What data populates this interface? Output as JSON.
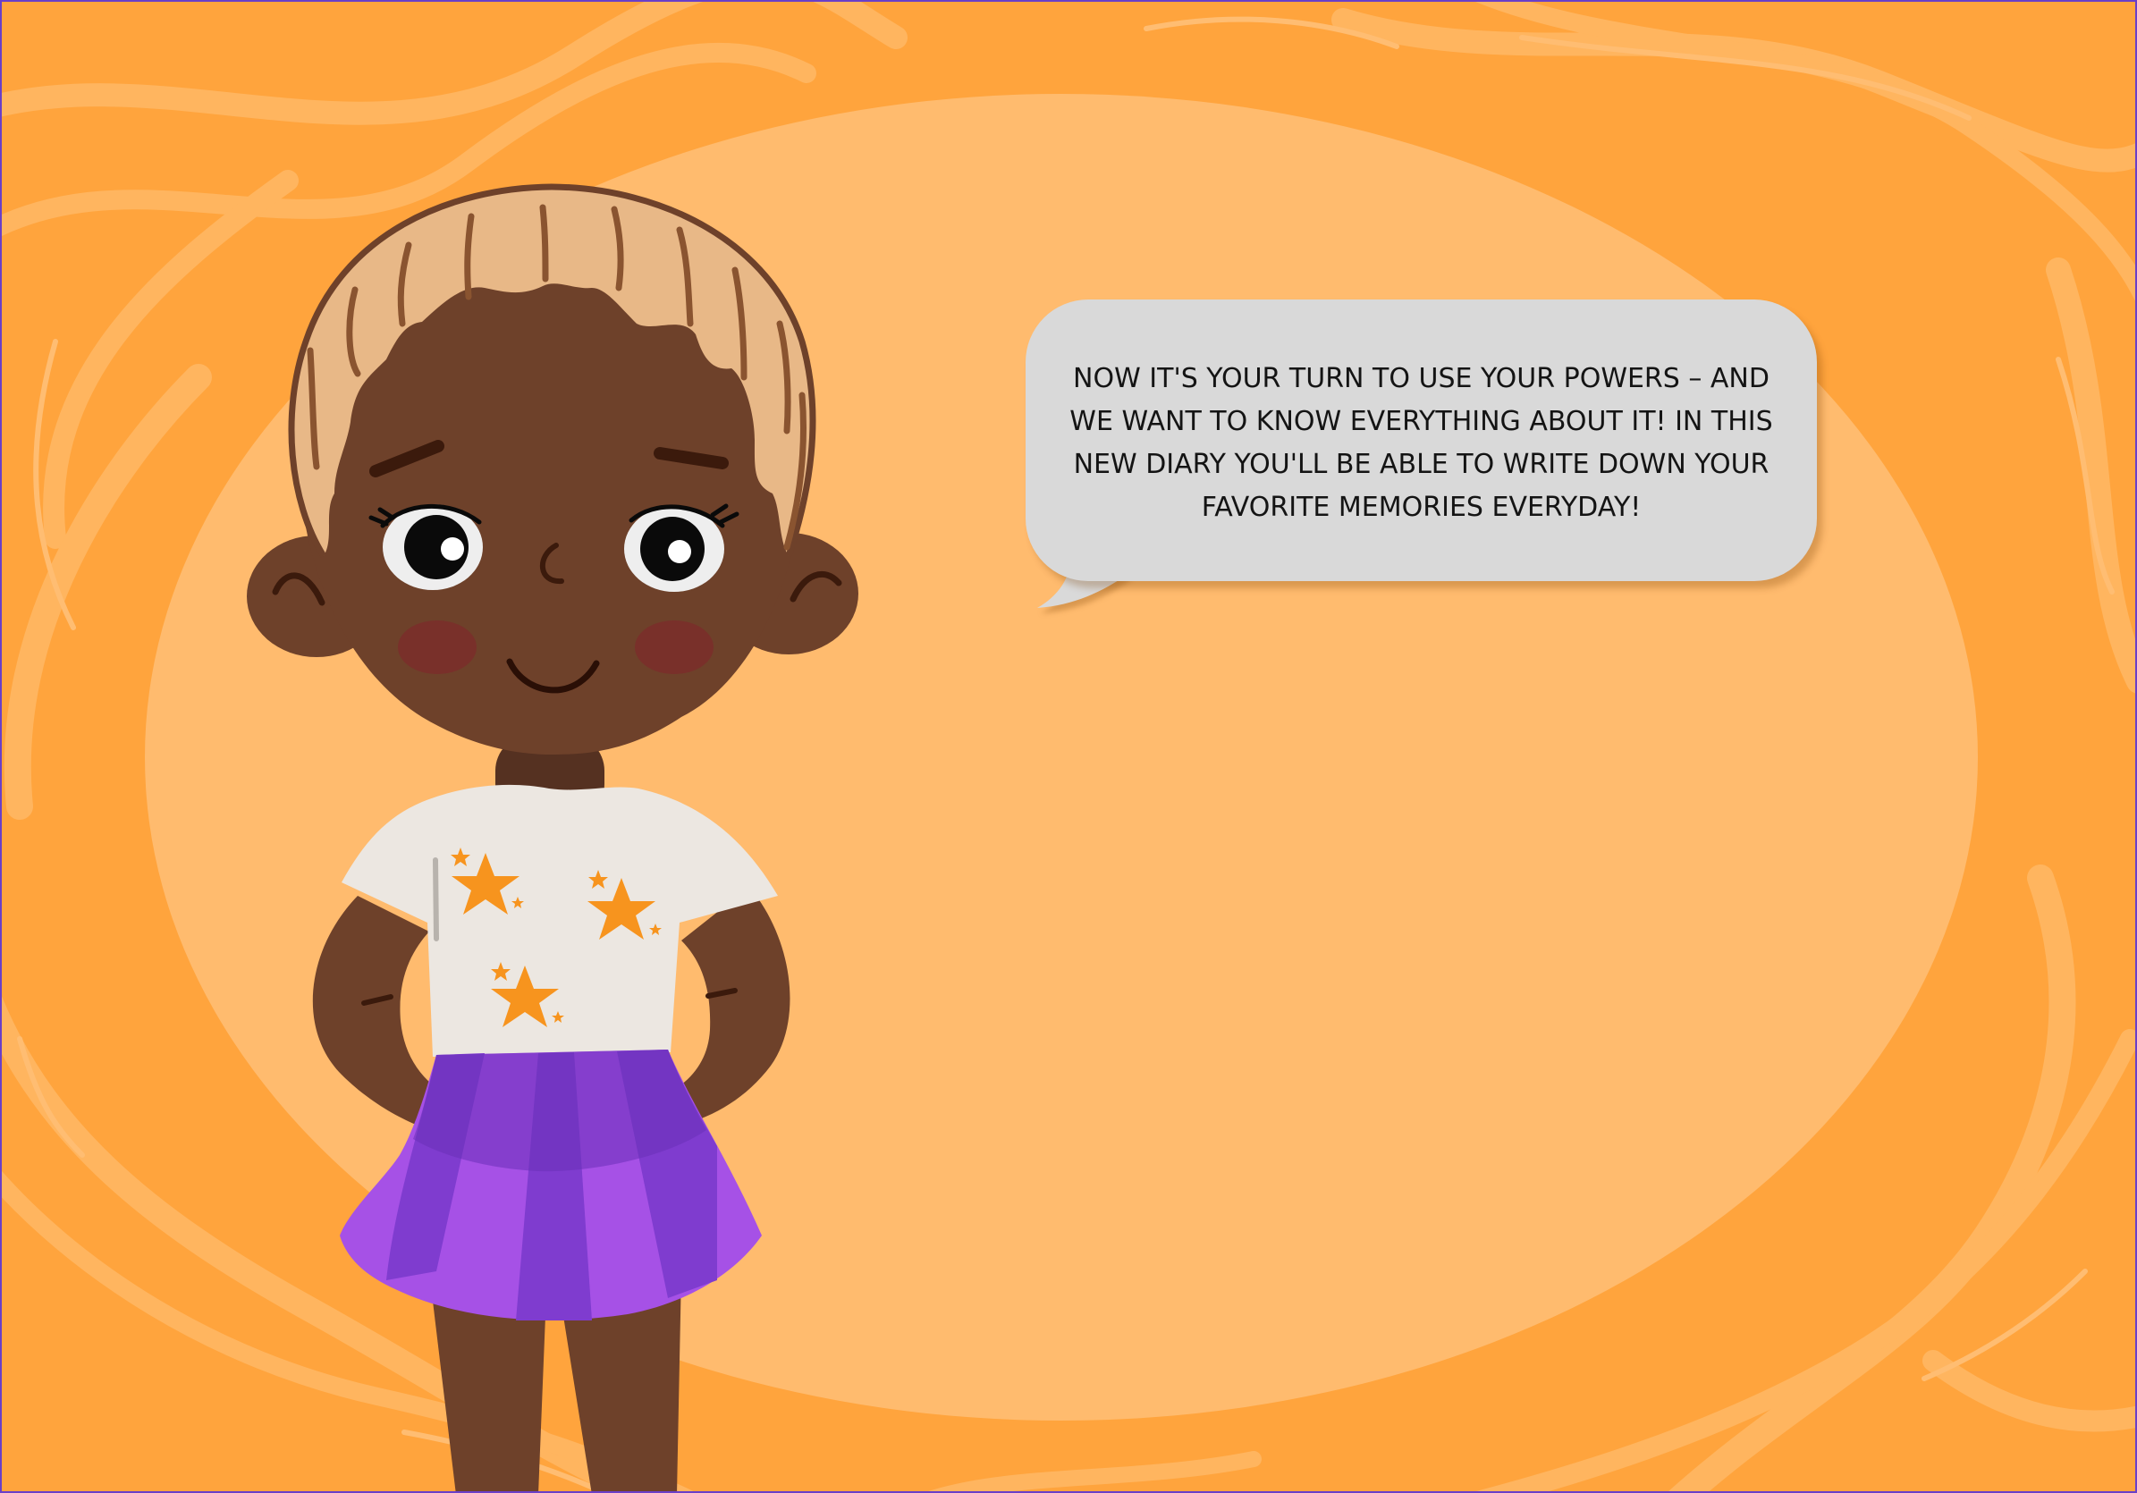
{
  "speech_bubble": {
    "text": "NOW IT'S YOUR TURN TO USE YOUR POWERS – AND\nWE WANT TO KNOW EVERYTHING ABOUT IT! IN THIS\nNEW DIARY YOU'LL BE ABLE TO WRITE DOWN YOUR\nFAVORITE MEMORIES EVERYDAY!"
  },
  "colors": {
    "background": "#ffa43d",
    "background_swirl": "#ffb55f",
    "center_oval": "#ffbb6e",
    "bubble": "#d9d9d9",
    "skin": "#6e412a",
    "hair": "#e8b887",
    "shirt": "#ece7e1",
    "stars": "#f7941e",
    "skirt": "#9b4ee0",
    "frame_border": "#6a3fc8"
  },
  "icons": [
    "girl-character-illustration",
    "star-icon",
    "speech-bubble-tail"
  ]
}
